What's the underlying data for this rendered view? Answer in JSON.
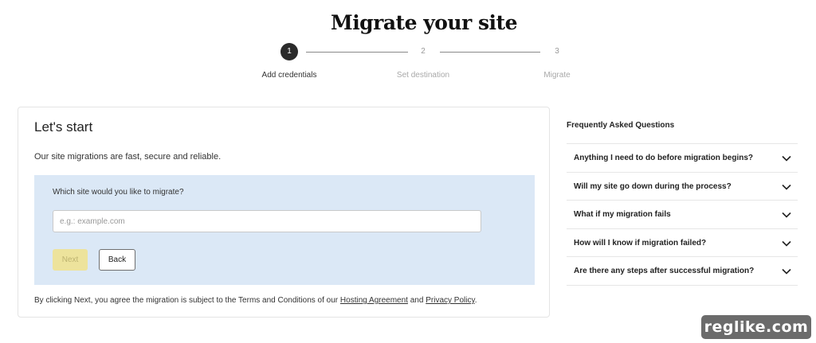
{
  "page": {
    "title": "Migrate your site"
  },
  "stepper": {
    "steps": [
      {
        "number": "1",
        "label": "Add credentials",
        "state": "active"
      },
      {
        "number": "2",
        "label": "Set destination",
        "state": "inactive"
      },
      {
        "number": "3",
        "label": "Migrate",
        "state": "inactive"
      }
    ]
  },
  "card": {
    "title": "Let's start",
    "subtitle": "Our site migrations are fast, secure and reliable.",
    "question": "Which site would you like to migrate?",
    "input_placeholder": "e.g.: example.com",
    "input_value": "",
    "next_label": "Next",
    "back_label": "Back",
    "terms": {
      "prefix": "By clicking Next, you agree the migration is subject to the Terms and Conditions of our ",
      "link1": "Hosting Agreement",
      "middle": " and ",
      "link2": "Privacy Policy",
      "suffix": "."
    }
  },
  "faq": {
    "title": "Frequently Asked Questions",
    "items": [
      {
        "question": "Anything I need to do before migration begins?",
        "icon": "chevron-down-icon"
      },
      {
        "question": "Will my site go down during the process?",
        "icon": "chevron-down-icon"
      },
      {
        "question": "What if my migration fails",
        "icon": "chevron-down-icon"
      },
      {
        "question": "How will I know if migration failed?",
        "icon": "chevron-down-icon"
      },
      {
        "question": "Are there any steps after successful migration?",
        "icon": "chevron-down-icon"
      }
    ]
  },
  "watermark": {
    "text": "reglike.com"
  },
  "colors": {
    "step_active": "#2b2b2b",
    "panel_bg": "#dbe8f6",
    "next_button_bg": "#ede39c",
    "watermark_bg": "#6b6b6b"
  }
}
